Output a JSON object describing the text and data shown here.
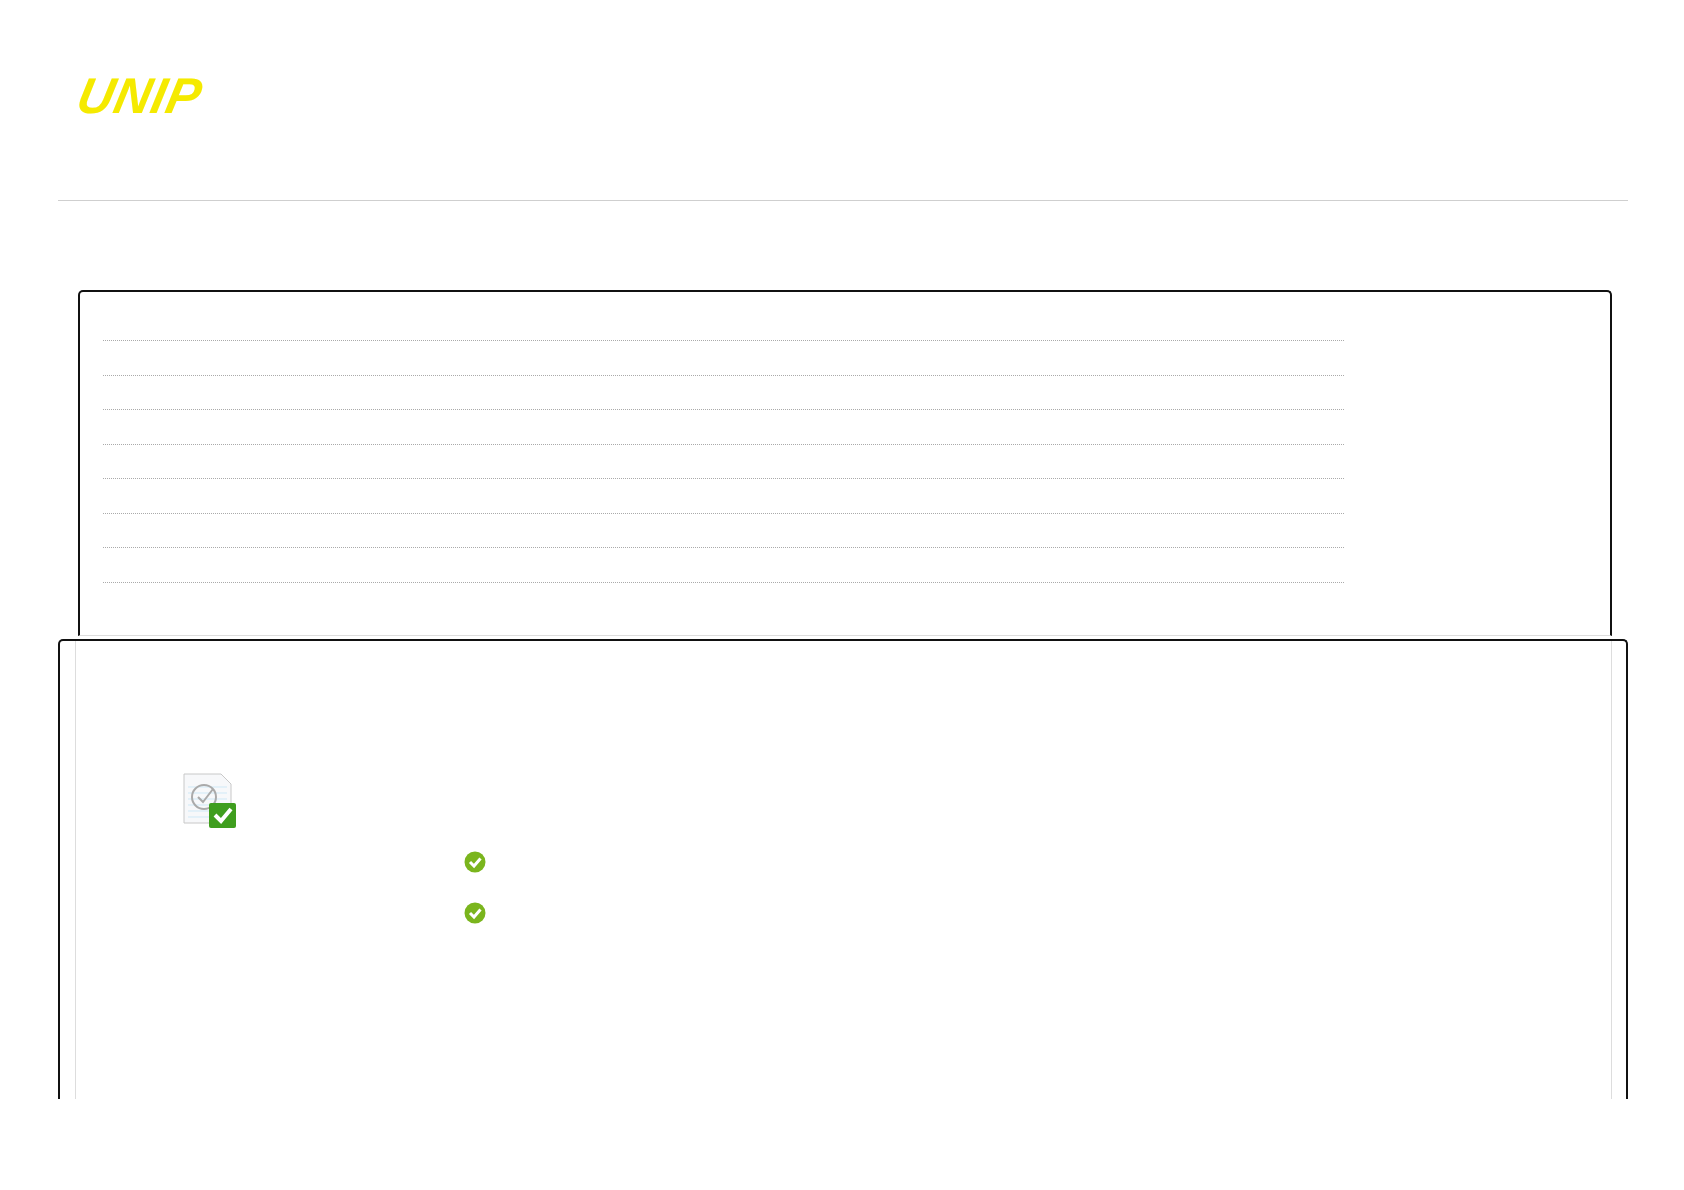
{
  "logo": {
    "text": "UNIP"
  }
}
